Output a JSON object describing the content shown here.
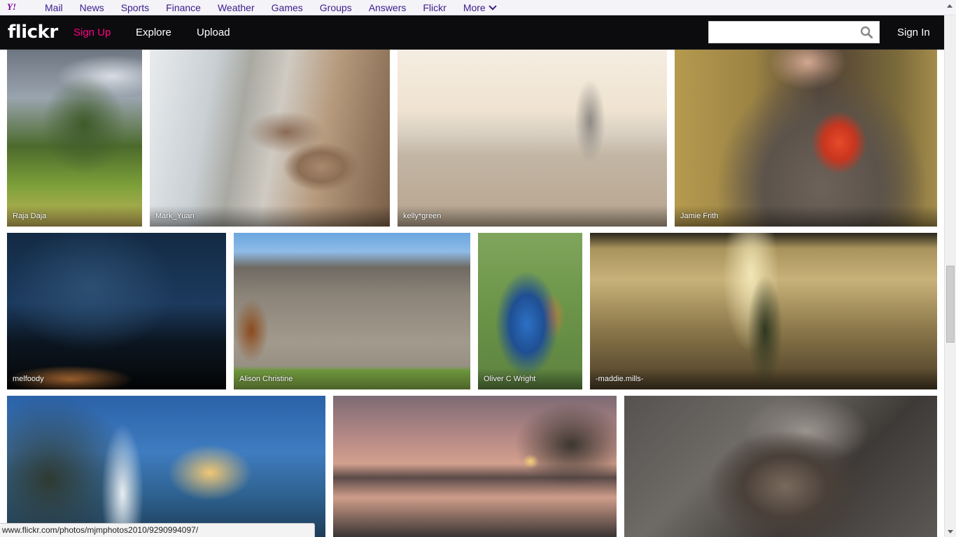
{
  "yahoo_bar": {
    "logo": "Y!",
    "nav": [
      "Mail",
      "News",
      "Sports",
      "Finance",
      "Weather",
      "Games",
      "Groups",
      "Answers",
      "Flickr",
      "More"
    ]
  },
  "header": {
    "logo": "flickr",
    "signup": "Sign Up",
    "explore": "Explore",
    "upload": "Upload",
    "search_placeholder": "",
    "signin": "Sign In"
  },
  "photos": [
    {
      "author": "Raja Daja"
    },
    {
      "author": "Mark_Yuan"
    },
    {
      "author": "kelly*green"
    },
    {
      "author": "Jamie Frith"
    },
    {
      "author": "melfoody"
    },
    {
      "author": "Alison Christine"
    },
    {
      "author": "Oliver C Wright"
    },
    {
      "author": "-maddie.mills-"
    },
    {
      "author": ""
    },
    {
      "author": ""
    },
    {
      "author": ""
    }
  ],
  "status_url": "www.flickr.com/photos/mjmphotos2010/9290994097/",
  "colors": {
    "yahoo_purple": "#3d1c8c",
    "flickr_pink": "#ff0084",
    "header_bg": "#0c0c0e"
  }
}
